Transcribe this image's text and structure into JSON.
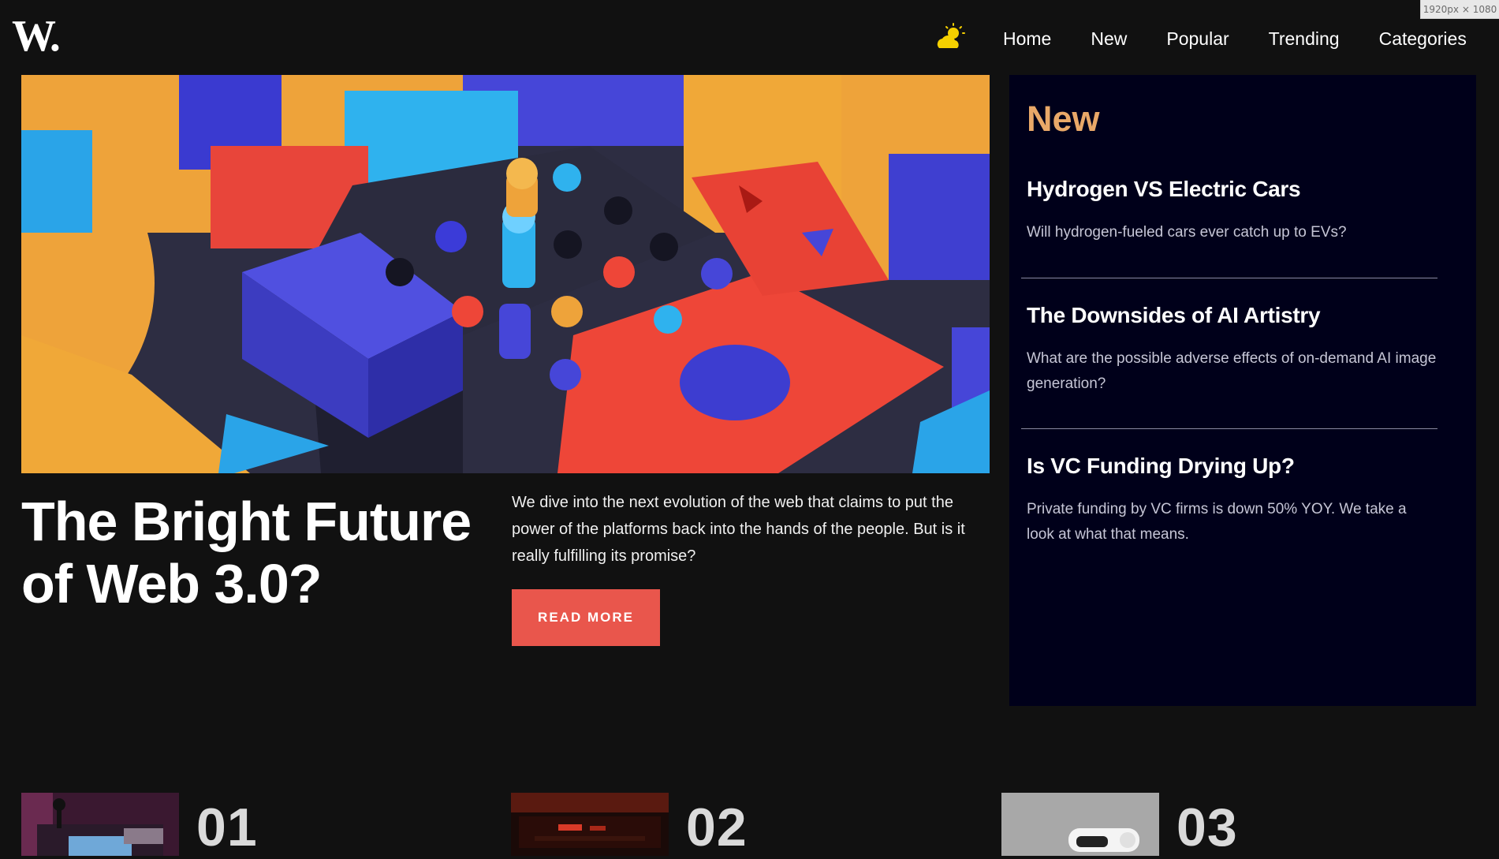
{
  "viewport_badge": "1920px × 1080",
  "header": {
    "logo": "W.",
    "theme_icon": "sun-cloud-icon",
    "nav": [
      {
        "label": "Home"
      },
      {
        "label": "New"
      },
      {
        "label": "Popular"
      },
      {
        "label": "Trending"
      },
      {
        "label": "Categories"
      }
    ]
  },
  "hero": {
    "image_icon": "abstract-3d-blocks-image",
    "title": "The Bright Future of Web 3.0?",
    "description": "We dive into the next evolution of the web that claims to put the power of the platforms back into the hands of the people. But is it really fulfilling its promise?",
    "button_label": "READ MORE"
  },
  "new_section": {
    "heading": "New",
    "items": [
      {
        "title": "Hydrogen VS Electric Cars",
        "summary": "Will hydrogen-fueled cars ever catch up to EVs?"
      },
      {
        "title": "The Downsides of AI Artistry",
        "summary": "What are the possible adverse effects of on-demand AI image generation?"
      },
      {
        "title": "Is VC Funding Drying Up?",
        "summary": "Private funding by VC firms is down 50% YOY. We take a look at what that means."
      }
    ]
  },
  "cards": [
    {
      "number": "01",
      "image_icon": "retro-arcade-joystick-image"
    },
    {
      "number": "02",
      "image_icon": "dark-keyboard-image"
    },
    {
      "number": "03",
      "image_icon": "white-vr-headset-image"
    }
  ],
  "colors": {
    "page_background": "#111111",
    "panel_background": "#00001a",
    "accent_orange": "#e9a868",
    "button_red": "#e9564c",
    "theme_icon_yellow": "#f5d000"
  }
}
